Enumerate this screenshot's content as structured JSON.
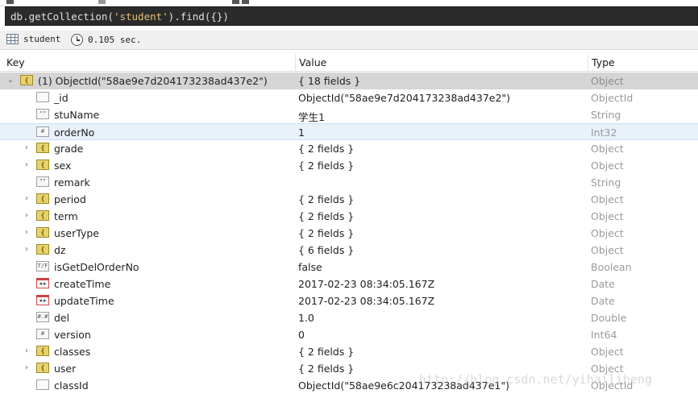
{
  "query": {
    "prefix": "db.getCollection(",
    "collection_arg": "'student'",
    "suffix": ").find({})"
  },
  "status": {
    "collection": "student",
    "time": "0.105 sec."
  },
  "columns": {
    "key": "Key",
    "value": "Value",
    "type": "Type"
  },
  "rows": [
    {
      "key": "(1) ObjectId(\"58ae9e7d204173238ad437e2\")",
      "value": "{ 18 fields }",
      "type": "Object",
      "icon": "object-icon",
      "expandable": true
    },
    {
      "key": "_id",
      "value": "ObjectId(\"58ae9e7d204173238ad437e2\")",
      "type": "ObjectId",
      "icon": "objectid-icon",
      "expandable": false
    },
    {
      "key": "stuName",
      "value": "学生1",
      "type": "String",
      "icon": "string-icon",
      "expandable": false
    },
    {
      "key": "orderNo",
      "value": "1",
      "type": "Int32",
      "icon": "number-icon",
      "expandable": false
    },
    {
      "key": "grade",
      "value": "{ 2 fields }",
      "type": "Object",
      "icon": "object-icon",
      "expandable": true
    },
    {
      "key": "sex",
      "value": "{ 2 fields }",
      "type": "Object",
      "icon": "object-icon",
      "expandable": true
    },
    {
      "key": "remark",
      "value": "",
      "type": "String",
      "icon": "string-icon",
      "expandable": false
    },
    {
      "key": "period",
      "value": "{ 2 fields }",
      "type": "Object",
      "icon": "object-icon",
      "expandable": true
    },
    {
      "key": "term",
      "value": "{ 2 fields }",
      "type": "Object",
      "icon": "object-icon",
      "expandable": true
    },
    {
      "key": "userType",
      "value": "{ 2 fields }",
      "type": "Object",
      "icon": "object-icon",
      "expandable": true
    },
    {
      "key": "dz",
      "value": "{ 6 fields }",
      "type": "Object",
      "icon": "object-icon",
      "expandable": true
    },
    {
      "key": "isGetDelOrderNo",
      "value": "false",
      "type": "Boolean",
      "icon": "boolean-icon",
      "expandable": false
    },
    {
      "key": "createTime",
      "value": "2017-02-23 08:34:05.167Z",
      "type": "Date",
      "icon": "date-icon",
      "expandable": false
    },
    {
      "key": "updateTime",
      "value": "2017-02-23 08:34:05.167Z",
      "type": "Date",
      "icon": "date-icon",
      "expandable": false
    },
    {
      "key": "del",
      "value": "1.0",
      "type": "Double",
      "icon": "double-icon",
      "expandable": false
    },
    {
      "key": "version",
      "value": "0",
      "type": "Int64",
      "icon": "number-icon",
      "expandable": false
    },
    {
      "key": "classes",
      "value": "{ 2 fields }",
      "type": "Object",
      "icon": "object-icon",
      "expandable": true
    },
    {
      "key": "user",
      "value": "{ 2 fields }",
      "type": "Object",
      "icon": "object-icon",
      "expandable": true
    },
    {
      "key": "classId",
      "value": "ObjectId(\"58ae9e6c204173238ad437e1\")",
      "type": "ObjectId",
      "icon": "objectid-icon",
      "expandable": false
    }
  ],
  "watermark": "http://blog.csdn.net/yihailiheng"
}
